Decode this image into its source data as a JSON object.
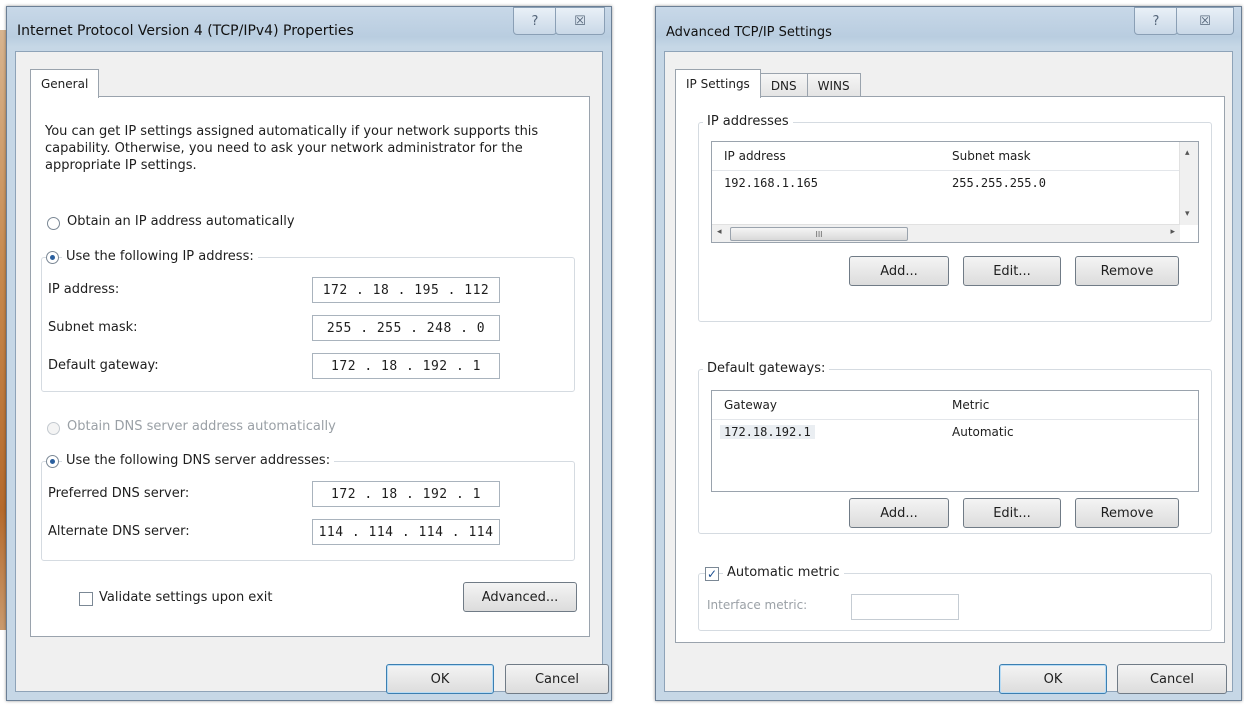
{
  "dialog1": {
    "title": "Internet Protocol Version 4 (TCP/IPv4) Properties",
    "help_glyph": "?",
    "close_glyph": "☒",
    "tab_general": "General",
    "intro": "You can get IP settings assigned automatically if your network supports this capability. Otherwise, you need to ask your network administrator for the appropriate IP settings.",
    "radio_obtain_ip": "Obtain an IP address automatically",
    "radio_use_ip": "Use the following IP address:",
    "ip_label": "IP address:",
    "ip_value": "172 . 18 . 195 . 112",
    "mask_label": "Subnet mask:",
    "mask_value": "255 . 255 . 248 . 0",
    "gateway_label": "Default gateway:",
    "gateway_value": "172 . 18 . 192 . 1",
    "radio_obtain_dns": "Obtain DNS server address automatically",
    "radio_use_dns": "Use the following DNS server addresses:",
    "pref_dns_label": "Preferred DNS server:",
    "pref_dns_value": "172 . 18 . 192 . 1",
    "alt_dns_label": "Alternate DNS server:",
    "alt_dns_value": "114 . 114 . 114 . 114",
    "validate_label": "Validate settings upon exit",
    "advanced_button": "Advanced...",
    "ok_button": "OK",
    "cancel_button": "Cancel"
  },
  "dialog2": {
    "title": "Advanced TCP/IP Settings",
    "help_glyph": "?",
    "close_glyph": "☒",
    "tabs": [
      "IP Settings",
      "DNS",
      "WINS"
    ],
    "ip_group_label": "IP addresses",
    "ip_columns": [
      "IP address",
      "Subnet mask"
    ],
    "ip_rows": [
      {
        "ip": "192.168.1.165",
        "mask": "255.255.255.0"
      }
    ],
    "scroll_grip": "III",
    "scroll_left": "◂",
    "scroll_right": "▸",
    "scroll_up": "▴",
    "scroll_down": "▾",
    "gw_group_label": "Default gateways:",
    "gw_columns": [
      "Gateway",
      "Metric"
    ],
    "gw_rows": [
      {
        "gateway": "172.18.192.1",
        "metric": "Automatic"
      }
    ],
    "add_button": "Add...",
    "edit_button": "Edit...",
    "remove_button": "Remove",
    "auto_metric_label": "Automatic metric",
    "check_glyph": "✓",
    "interface_metric_label": "Interface metric:",
    "ok_button": "OK",
    "cancel_button": "Cancel"
  }
}
